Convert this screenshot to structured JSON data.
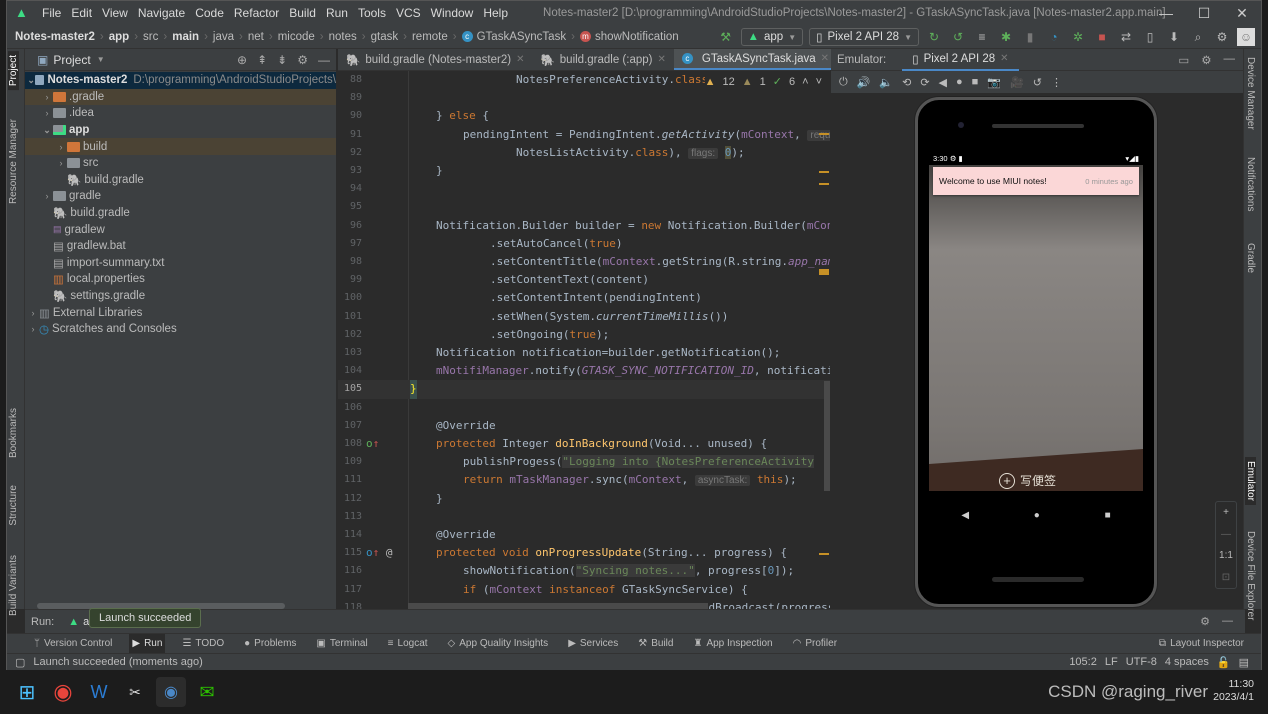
{
  "window": {
    "menu": [
      "File",
      "Edit",
      "View",
      "Navigate",
      "Code",
      "Refactor",
      "Build",
      "Run",
      "Tools",
      "VCS",
      "Window",
      "Help"
    ],
    "title": "Notes-master2 [D:\\programming\\AndroidStudioProjects\\Notes-master2] - GTaskASyncTask.java [Notes-master2.app.main]",
    "controls": {
      "minimize": "—",
      "maximize": "☐",
      "close": "✕"
    }
  },
  "breadcrumb": [
    "Notes-master2",
    "app",
    "src",
    "main",
    "java",
    "net",
    "micode",
    "notes",
    "gtask",
    "remote",
    "GTaskASyncTask",
    "showNotification"
  ],
  "toolbar": {
    "run_config": "app",
    "device": "Pixel 2 API 28"
  },
  "left_stripe": {
    "project": "Project",
    "resource_manager": "Resource Manager",
    "bookmarks": "Bookmarks",
    "structure": "Structure",
    "build_variants": "Build Variants"
  },
  "right_stripe": {
    "device_manager": "Device Manager",
    "notifications": "Notifications",
    "gradle": "Gradle",
    "emulator": "Emulator",
    "device_file_explorer": "Device File Explorer"
  },
  "project": {
    "title": "Project",
    "tree": [
      {
        "label": "Notes-master2",
        "path": "D:\\programming\\AndroidStudioProjects\\"
      },
      {
        "label": ".gradle"
      },
      {
        "label": ".idea"
      },
      {
        "label": "app"
      },
      {
        "label": "build"
      },
      {
        "label": "src"
      },
      {
        "label": "build.gradle"
      },
      {
        "label": "gradle"
      },
      {
        "label": "build.gradle"
      },
      {
        "label": "gradlew"
      },
      {
        "label": "gradlew.bat"
      },
      {
        "label": "import-summary.txt"
      },
      {
        "label": "local.properties"
      },
      {
        "label": "settings.gradle"
      },
      {
        "label": "External Libraries"
      },
      {
        "label": "Scratches and Consoles"
      }
    ]
  },
  "editor": {
    "tabs": [
      "build.gradle (Notes-master2)",
      "build.gradle (:app)",
      "GTaskASyncTask.java"
    ],
    "inspections": {
      "warnings": "12",
      "weak_warnings": "1",
      "ok": "6"
    },
    "line_numbers": [
      "88",
      "89",
      "90",
      "91",
      "92",
      "93",
      "94",
      "95",
      "96",
      "97",
      "98",
      "99",
      "100",
      "101",
      "102",
      "103",
      "104",
      "105",
      "106",
      "107",
      "108",
      "109",
      "111",
      "112",
      "113",
      "114",
      "115",
      "116",
      "117",
      "118"
    ],
    "hints": {
      "flags": "flags:",
      "async_task": "asyncTask:",
      "requ": "requ"
    }
  },
  "emulator": {
    "label": "Emulator:",
    "tab": "Pixel 2 API 28",
    "phone": {
      "time": "3:30",
      "notification_title": "Welcome to use MIUI notes!",
      "notification_time": "0 minutes ago",
      "write_note": "写便签"
    },
    "zoom": {
      "in": "+",
      "out": "—",
      "actual": "1:1"
    }
  },
  "run": {
    "label": "Run:",
    "config": "a",
    "tooltip": "Launch succeeded"
  },
  "toolwindows": [
    "Version Control",
    "Run",
    "TODO",
    "Problems",
    "Terminal",
    "Logcat",
    "App Quality Insights",
    "Services",
    "Build",
    "App Inspection",
    "Profiler"
  ],
  "layout_inspector": "Layout Inspector",
  "status": {
    "message": "Launch succeeded (moments ago)",
    "position": "105:2",
    "line_sep": "LF",
    "encoding": "UTF-8",
    "indent": "4 spaces"
  },
  "taskbar": {
    "time": "11:30",
    "date": "2023/4/1",
    "watermark": "CSDN @raging_river"
  }
}
